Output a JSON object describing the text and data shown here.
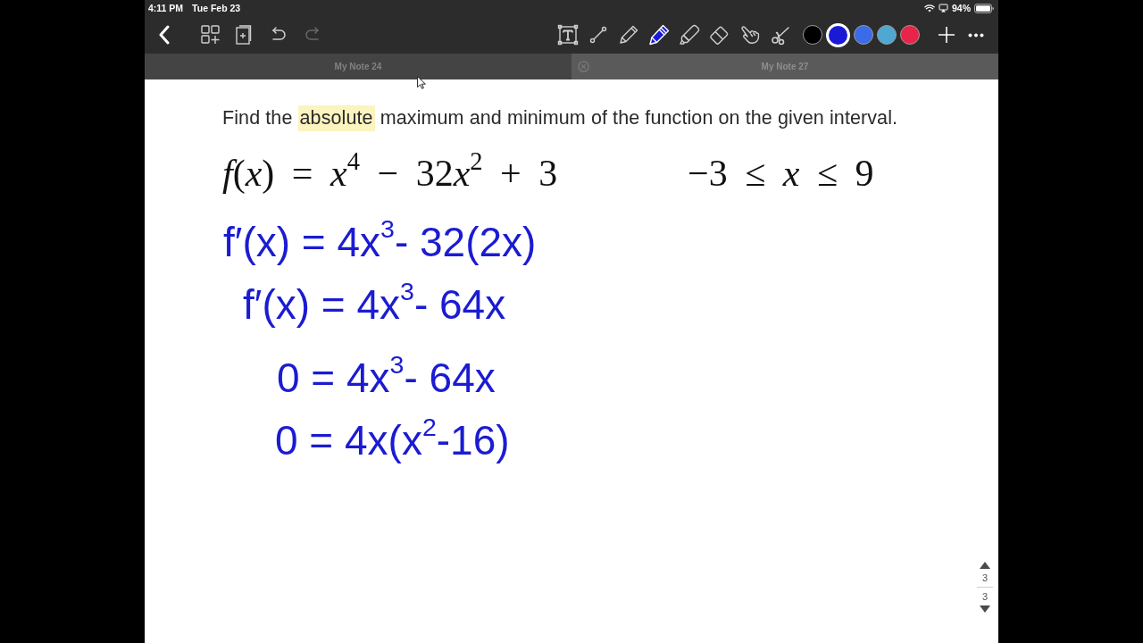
{
  "status_bar": {
    "time": "4:11 PM",
    "date": "Tue Feb 23",
    "battery": "94%"
  },
  "toolbar": {
    "left_buttons": [
      {
        "kind": "back",
        "disabled": false
      },
      {
        "kind": "pages",
        "disabled": false
      },
      {
        "kind": "add_page",
        "disabled": false
      },
      {
        "kind": "undo",
        "disabled": false
      },
      {
        "kind": "redo",
        "disabled": true
      }
    ],
    "tools": [
      {
        "kind": "text",
        "selected": false
      },
      {
        "kind": "line",
        "selected": false
      },
      {
        "kind": "pencil",
        "selected": false
      },
      {
        "kind": "pen",
        "selected": true
      },
      {
        "kind": "highlighter",
        "selected": false
      },
      {
        "kind": "eraser",
        "selected": false
      },
      {
        "kind": "hand",
        "selected": false
      },
      {
        "kind": "scissors",
        "selected": false
      }
    ],
    "colors": [
      {
        "color": "#000000",
        "selected": false
      },
      {
        "color": "#1a1ad6",
        "selected": true
      },
      {
        "color": "#3a6cea",
        "selected": false
      },
      {
        "color": "#4ea8d2",
        "selected": false
      },
      {
        "color": "#e8244a",
        "selected": false
      }
    ],
    "right_buttons": [
      {
        "kind": "add"
      },
      {
        "kind": "more"
      }
    ]
  },
  "tabs": [
    {
      "label": "My Note 24",
      "selected": false
    },
    {
      "label": "My Note 27",
      "selected": true
    }
  ],
  "question": {
    "segments": [
      {
        "text": "Find the ",
        "highlighted": false
      },
      {
        "text": "absolute",
        "highlighted": true
      },
      {
        "text": " maximum and minimum of the function on the given interval.",
        "highlighted": false
      }
    ]
  },
  "equation": "f(x) = x$^{4}$ − 32x$^{2}$ + 3",
  "interval": "−3 ≤ x ≤ 9",
  "handwriting": [
    "f′(x) = 4x$^{3}$- 32(2x)",
    "f′(x) = 4x$^{3}$- 64x",
    "0 = 4x$^{3}$- 64x",
    "0 = 4x(x$^{2}$-16)"
  ],
  "page_navigator": {
    "current": "3",
    "total": "3"
  }
}
